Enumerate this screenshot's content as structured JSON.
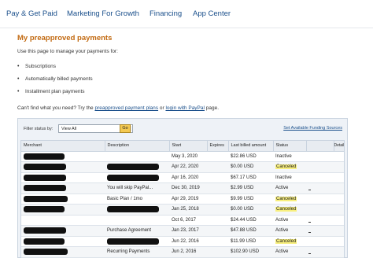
{
  "nav": {
    "items": [
      "Pay & Get Paid",
      "Marketing For Growth",
      "Financing",
      "App Center"
    ]
  },
  "page": {
    "title": "My preapproved payments",
    "intro": "Use this page to manage your payments for:",
    "bullets": [
      "Subscriptions",
      "Automatically billed payments",
      "Installment plan payments"
    ],
    "help_prefix": "Can't find what you need? Try the",
    "help_link1": "preapproved payment plans",
    "help_or": "or",
    "help_link2": "login with PayPal",
    "help_suffix": "page."
  },
  "filter": {
    "label": "Filter status by:",
    "selected": "View All",
    "go_label": "Go",
    "set_funding_link": "Set Available Funding Sources"
  },
  "table": {
    "headers": [
      "Merchant",
      "Description",
      "Start",
      "Expires",
      "Last billed amount",
      "Status",
      "Details"
    ],
    "rows": [
      {
        "merchant_redacted": true,
        "desc": "",
        "desc_redacted": false,
        "start": "May 3, 2020",
        "last": "$22.86 USD",
        "status": "Inactive",
        "canceled": false
      },
      {
        "merchant_redacted": true,
        "desc": "",
        "desc_redacted": true,
        "start": "Apr 22, 2020",
        "last": "$0.00 USD",
        "status": "Canceled",
        "canceled": true
      },
      {
        "merchant_redacted": true,
        "desc": "",
        "desc_redacted": true,
        "start": "Apr 16, 2020",
        "last": "$67.17 USD",
        "status": "Inactive",
        "canceled": false
      },
      {
        "merchant_redacted": true,
        "desc": "You will skip PayPal...",
        "desc_redacted": false,
        "start": "Dec 30, 2019",
        "last": "$2.99 USD",
        "status": "Active",
        "canceled": false
      },
      {
        "merchant_redacted": true,
        "desc": "Basic Plan / 1mo",
        "desc_redacted": false,
        "start": "Apr 29, 2019",
        "last": "$9.99 USD",
        "status": "Canceled",
        "canceled": true
      },
      {
        "merchant_redacted": true,
        "desc": "",
        "desc_redacted": true,
        "start": "Jan 25, 2018",
        "last": "$0.00 USD",
        "status": "Canceled",
        "canceled": true
      },
      {
        "merchant_redacted": false,
        "desc": "",
        "desc_redacted": false,
        "start": "Oct 6, 2017",
        "last": "$24.44 USD",
        "status": "Active",
        "canceled": false
      },
      {
        "merchant_redacted": true,
        "desc": "Purchase Agreement",
        "desc_redacted": false,
        "start": "Jan 23, 2017",
        "last": "$47.88 USD",
        "status": "Active",
        "canceled": false
      },
      {
        "merchant_redacted": true,
        "desc": "",
        "desc_redacted": true,
        "start": "Jun 22, 2016",
        "last": "$11.99 USD",
        "status": "Canceled",
        "canceled": true
      },
      {
        "merchant_redacted": true,
        "desc": "Recurring Payments",
        "desc_redacted": false,
        "start": "Jun 2, 2016",
        "last": "$102.90 USD",
        "status": "Active",
        "canceled": false
      }
    ]
  }
}
